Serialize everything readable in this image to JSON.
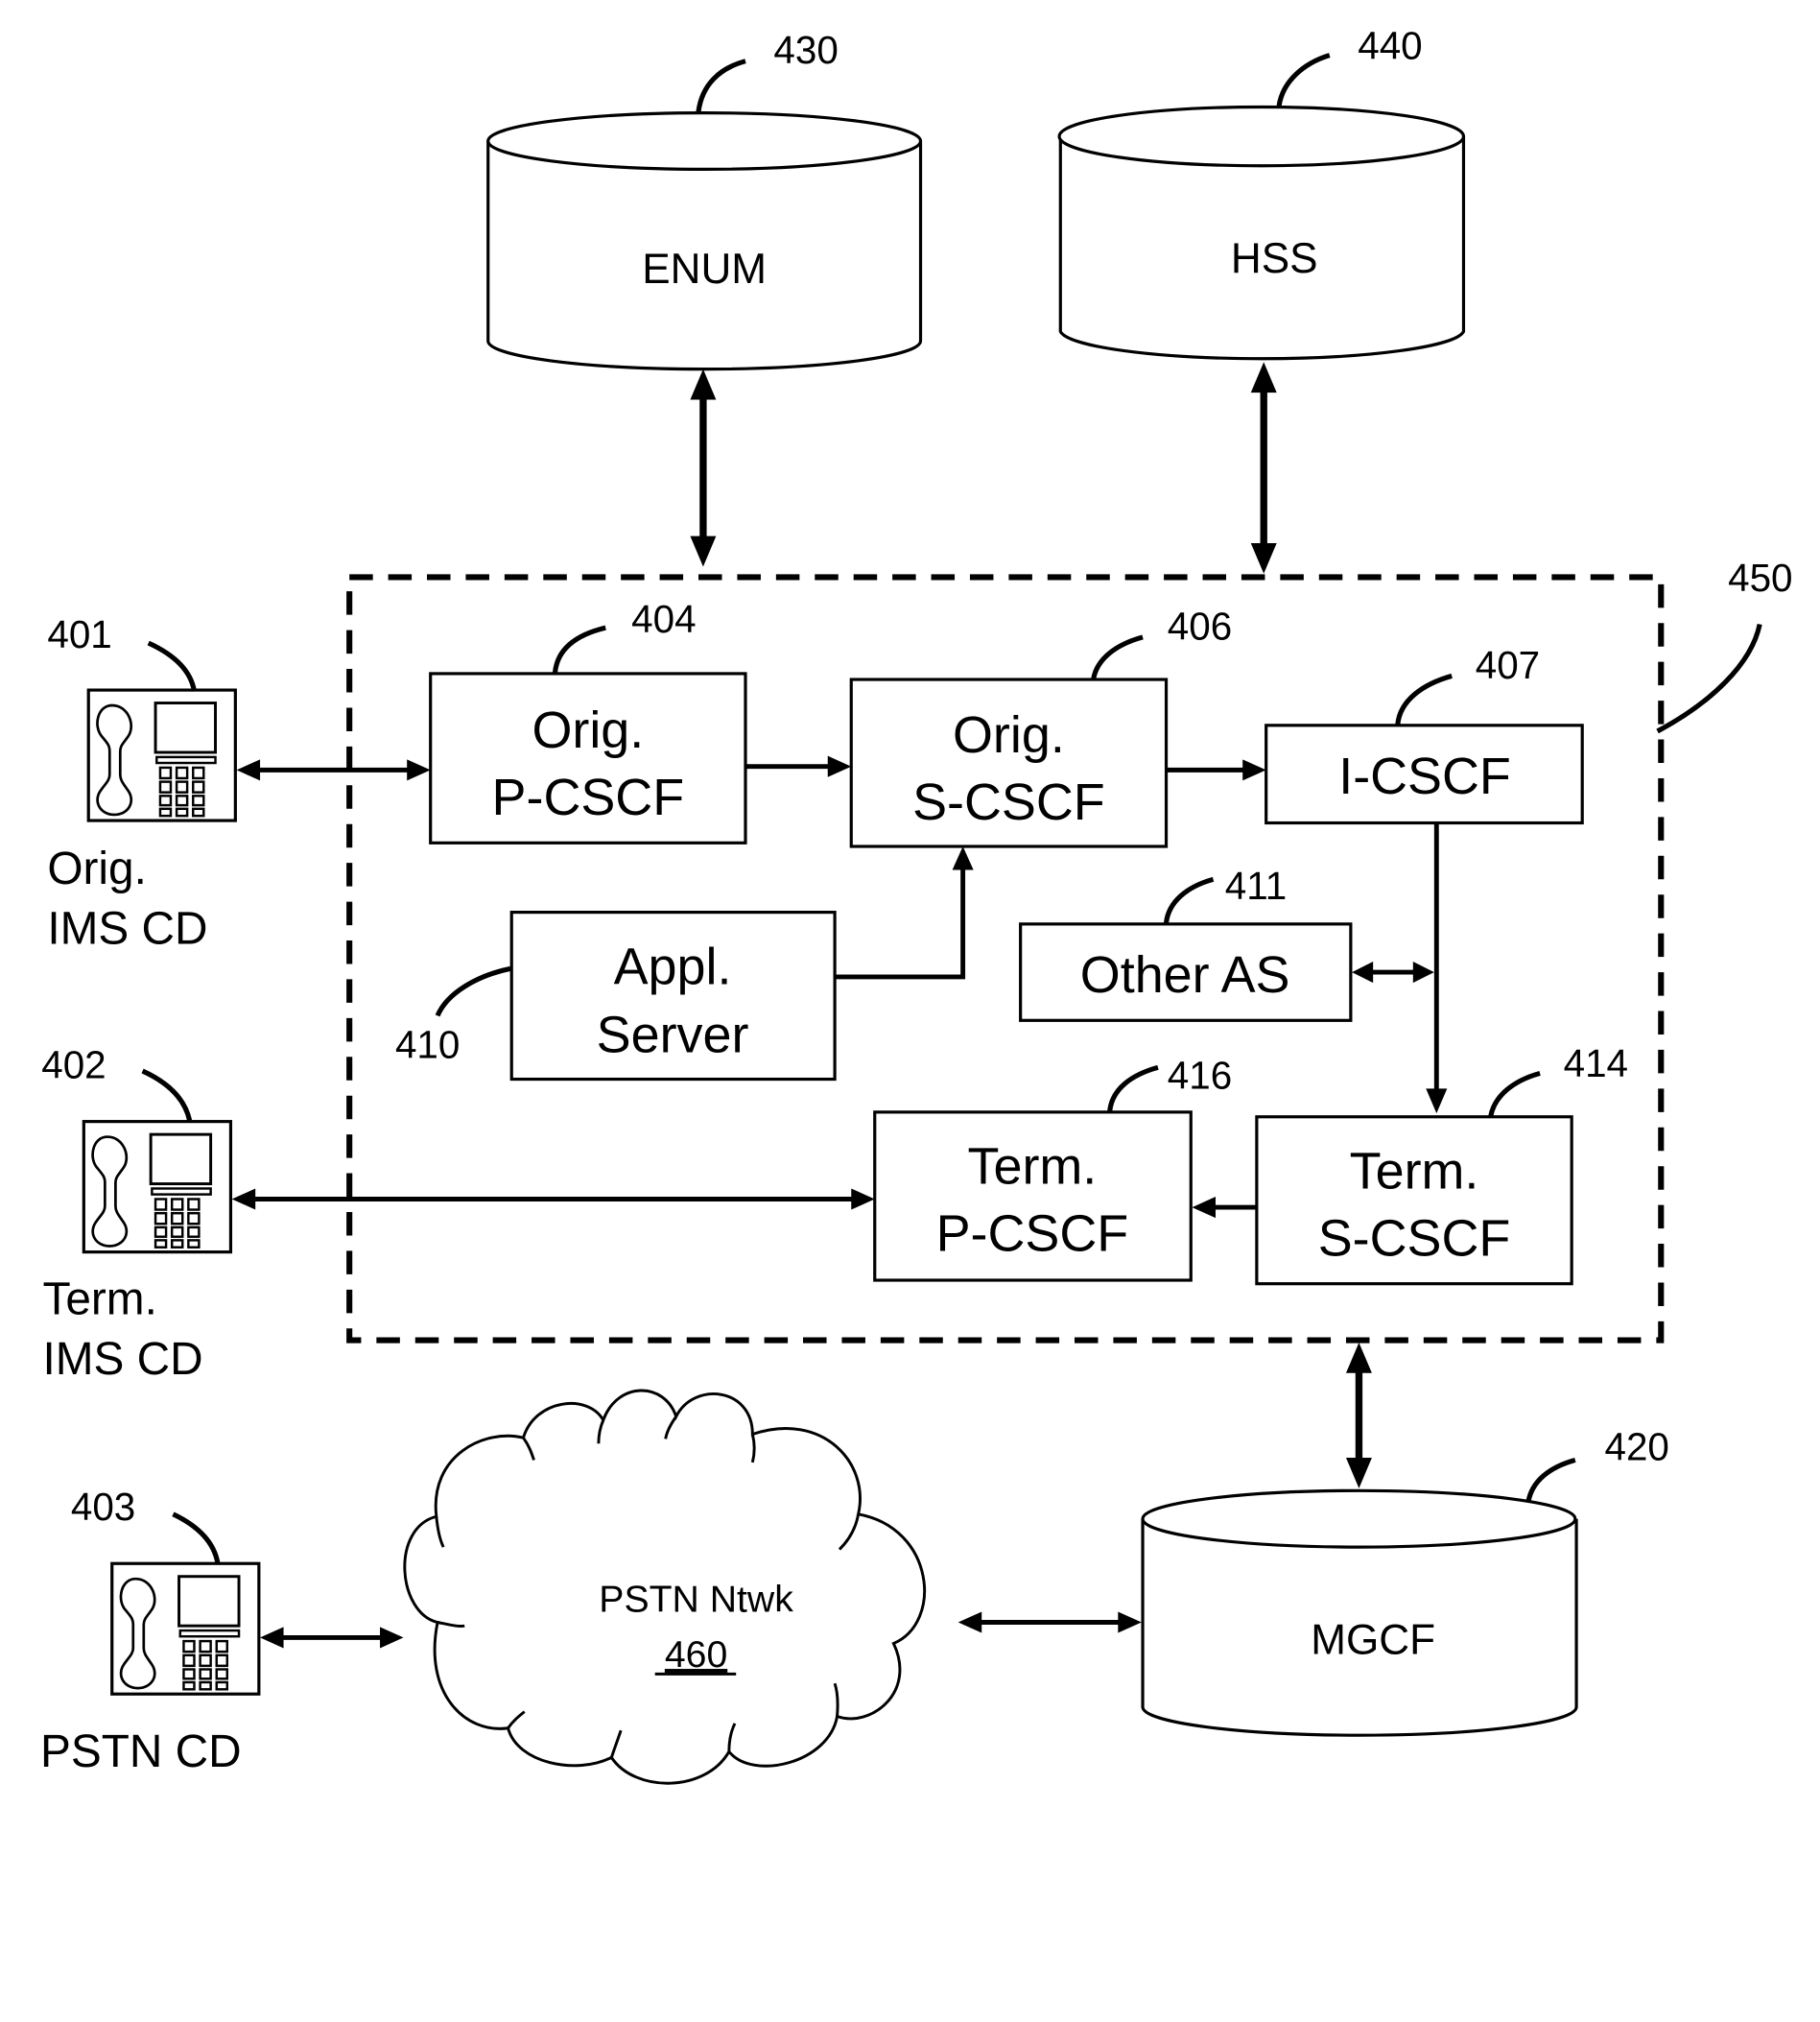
{
  "figure": {
    "container_ref": "450",
    "databases": {
      "enum": {
        "label": "ENUM",
        "ref": "430"
      },
      "hss": {
        "label": "HSS",
        "ref": "440"
      },
      "mgcf": {
        "label": "MGCF",
        "ref": "420"
      }
    },
    "nodes": {
      "orig_pcscf": {
        "line1": "Orig.",
        "line2": "P-CSCF",
        "ref": "404"
      },
      "orig_scscf": {
        "line1": "Orig.",
        "line2": "S-CSCF",
        "ref": "406"
      },
      "icscf": {
        "label": "I-CSCF",
        "ref": "407"
      },
      "appl_server": {
        "line1": "Appl.",
        "line2": "Server",
        "ref": "410"
      },
      "other_as": {
        "label": "Other AS",
        "ref": "411"
      },
      "term_pcscf": {
        "line1": "Term.",
        "line2": "P-CSCF",
        "ref": "416"
      },
      "term_scscf": {
        "line1": "Term.",
        "line2": "S-CSCF",
        "ref": "414"
      }
    },
    "devices": {
      "orig_ims_cd": {
        "line1": "Orig.",
        "line2": "IMS CD",
        "ref": "401"
      },
      "term_ims_cd": {
        "line1": "Term.",
        "line2": "IMS CD",
        "ref": "402"
      },
      "pstn_cd": {
        "label": "PSTN CD",
        "ref": "403"
      }
    },
    "network": {
      "label": "PSTN Ntwk",
      "ref": "460"
    },
    "connections": [
      {
        "from": "ENUM",
        "to": "IMS network 450",
        "direction": "bidirectional"
      },
      {
        "from": "HSS",
        "to": "IMS network 450",
        "direction": "bidirectional"
      },
      {
        "from": "Orig. IMS CD",
        "to": "Orig. P-CSCF",
        "direction": "bidirectional"
      },
      {
        "from": "Orig. P-CSCF",
        "to": "Orig. S-CSCF",
        "direction": "forward"
      },
      {
        "from": "Orig. S-CSCF",
        "to": "I-CSCF",
        "direction": "forward"
      },
      {
        "from": "Appl. Server",
        "to": "Orig. S-CSCF",
        "direction": "forward"
      },
      {
        "from": "I-CSCF",
        "to": "Term. S-CSCF",
        "direction": "forward"
      },
      {
        "from": "Other AS",
        "to": "I-CSCF / Term. S-CSCF path",
        "direction": "bidirectional"
      },
      {
        "from": "Term. S-CSCF",
        "to": "Term. P-CSCF",
        "direction": "forward"
      },
      {
        "from": "Term. P-CSCF",
        "to": "Term. IMS CD",
        "direction": "bidirectional"
      },
      {
        "from": "IMS network 450",
        "to": "MGCF",
        "direction": "bidirectional"
      },
      {
        "from": "PSTN CD",
        "to": "PSTN Ntwk",
        "direction": "bidirectional"
      },
      {
        "from": "PSTN Ntwk",
        "to": "MGCF",
        "direction": "bidirectional"
      }
    ]
  }
}
